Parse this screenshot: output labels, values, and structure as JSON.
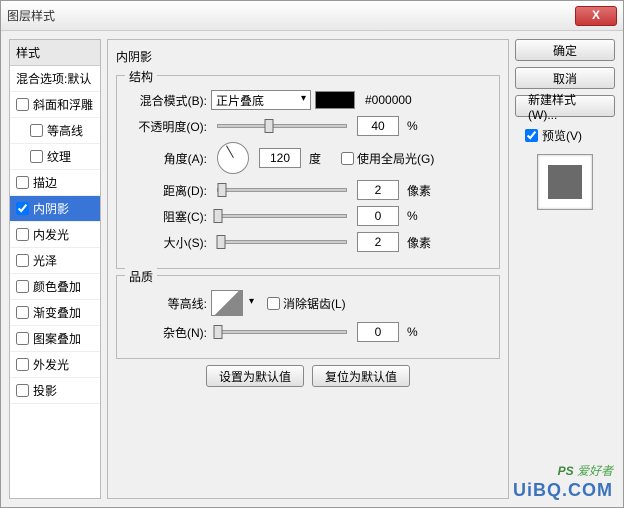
{
  "window": {
    "title": "图层样式",
    "close": "X"
  },
  "sidebar": {
    "header": "样式",
    "blend_defaults": "混合选项:默认",
    "items": [
      {
        "label": "斜面和浮雕",
        "checked": false,
        "indent": false
      },
      {
        "label": "等高线",
        "checked": false,
        "indent": true
      },
      {
        "label": "纹理",
        "checked": false,
        "indent": true
      },
      {
        "label": "描边",
        "checked": false,
        "indent": false
      },
      {
        "label": "内阴影",
        "checked": true,
        "indent": false,
        "selected": true
      },
      {
        "label": "内发光",
        "checked": false,
        "indent": false
      },
      {
        "label": "光泽",
        "checked": false,
        "indent": false
      },
      {
        "label": "颜色叠加",
        "checked": false,
        "indent": false
      },
      {
        "label": "渐变叠加",
        "checked": false,
        "indent": false
      },
      {
        "label": "图案叠加",
        "checked": false,
        "indent": false
      },
      {
        "label": "外发光",
        "checked": false,
        "indent": false
      },
      {
        "label": "投影",
        "checked": false,
        "indent": false
      }
    ]
  },
  "main": {
    "title": "内阴影",
    "structure": {
      "group_title": "结构",
      "blend_mode_label": "混合模式(B):",
      "blend_mode_value": "正片叠底",
      "color_hex": "#000000",
      "opacity_label": "不透明度(O):",
      "opacity_value": "40",
      "opacity_unit": "%",
      "angle_label": "角度(A):",
      "angle_value": "120",
      "angle_unit": "度",
      "global_light_label": "使用全局光(G)",
      "global_light_checked": false,
      "distance_label": "距离(D):",
      "distance_value": "2",
      "distance_unit": "像素",
      "choke_label": "阻塞(C):",
      "choke_value": "0",
      "choke_unit": "%",
      "size_label": "大小(S):",
      "size_value": "2",
      "size_unit": "像素"
    },
    "quality": {
      "group_title": "品质",
      "contour_label": "等高线:",
      "antialias_label": "消除锯齿(L)",
      "antialias_checked": false,
      "noise_label": "杂色(N):",
      "noise_value": "0",
      "noise_unit": "%"
    },
    "buttons": {
      "default_set": "设置为默认值",
      "default_reset": "复位为默认值"
    }
  },
  "right": {
    "ok": "确定",
    "cancel": "取消",
    "new_style": "新建样式(W)...",
    "preview_label": "预览(V)",
    "preview_checked": true
  },
  "watermark": {
    "line1_prefix": "PS",
    "line1_suffix": " 爱好者",
    "line2": "UiBQ.COM"
  }
}
